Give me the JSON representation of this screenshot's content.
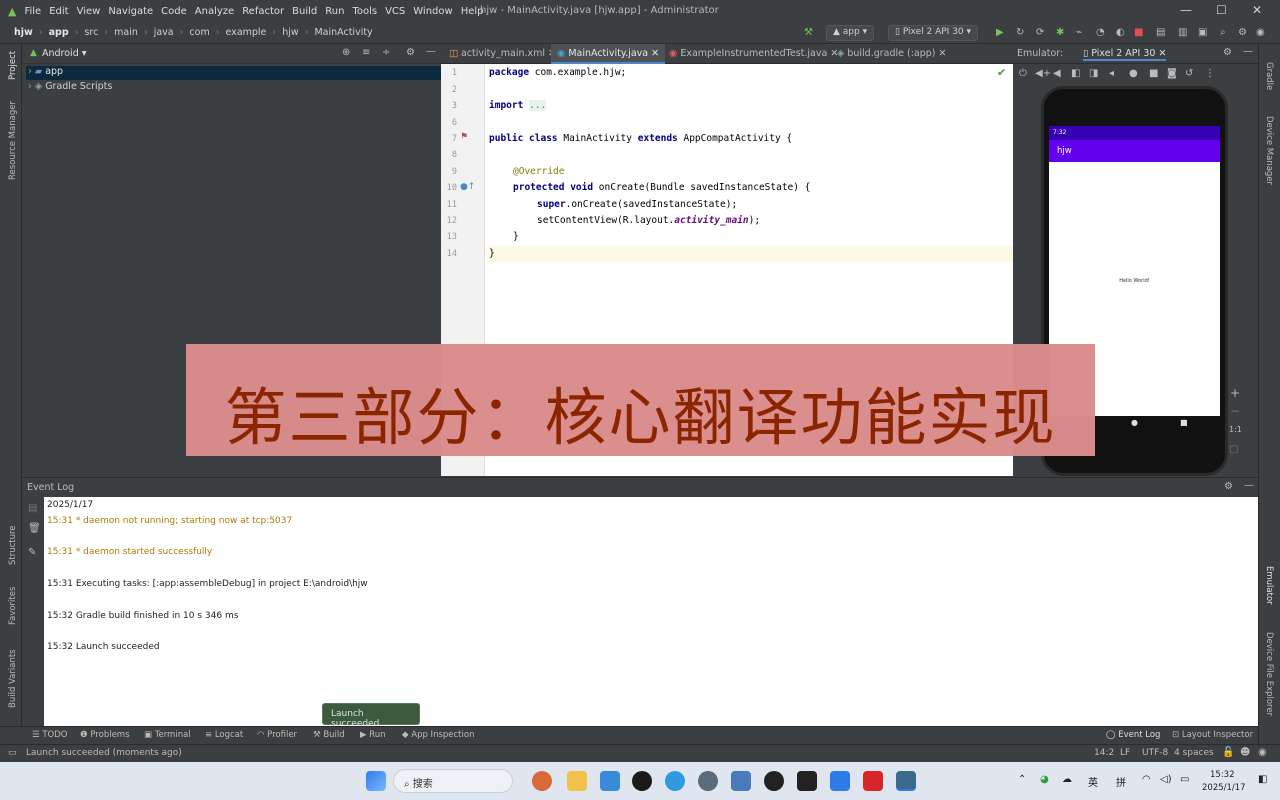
{
  "window": {
    "title": "hjw - MainActivity.java [hjw.app] - Administrator",
    "menu": [
      "File",
      "Edit",
      "View",
      "Navigate",
      "Code",
      "Analyze",
      "Refactor",
      "Build",
      "Run",
      "Tools",
      "VCS",
      "Window",
      "Help"
    ]
  },
  "breadcrumb": [
    "hjw",
    "app",
    "src",
    "main",
    "java",
    "com",
    "example",
    "hjw",
    "MainActivity"
  ],
  "toolbar": {
    "run_config": "app",
    "device": "Pixel 2 API 30"
  },
  "left_strip": [
    "Project",
    "Resource Manager",
    "Structure",
    "Favorites",
    "Build Variants"
  ],
  "project": {
    "view_selector": "Android",
    "items": [
      "app",
      "Gradle Scripts"
    ]
  },
  "editor": {
    "tabs": [
      "activity_main.xml",
      "MainActivity.java",
      "ExampleInstrumentedTest.java",
      "build.gradle (:app)"
    ],
    "line_numbers": [
      "1",
      "2",
      "3",
      "6",
      "7",
      "8",
      "9",
      "10",
      "11",
      "12",
      "13",
      "14"
    ],
    "code": {
      "l1_kw": "package",
      "l1_rest": " com.example.hjw;",
      "l3_kw": "import",
      "l3_fold": "...",
      "l7_kw1": "public class",
      "l7_name": " MainActivity ",
      "l7_kw2": "extends",
      "l7_rest": " AppCompatActivity {",
      "l9_ann": "@Override",
      "l10_kw": "protected void",
      "l10_rest": " onCreate(Bundle savedInstanceState) {",
      "l11_kw": "super",
      ".l11_rest": "",
      "l11_rest": ".onCreate(savedInstanceState);",
      "l12_rest1": "setContentView(R.layout.",
      "l12_it": "activity_main",
      "l12_rest2": ");",
      "l13": "}",
      "l14": "}"
    }
  },
  "emulator": {
    "header_label": "Emulator:",
    "tab": "Pixel 2 API 30",
    "app_title": "hjw",
    "status_time": "7:32",
    "body_text": "Hello World!",
    "zoom": "1:1"
  },
  "right_strip": [
    "Gradle",
    "Device Manager",
    "Emulator",
    "Device File Explorer"
  ],
  "event_log": {
    "title": "Event Log",
    "date": "2025/1/17",
    "lines": [
      {
        "time": "15:31",
        "text": "* daemon not running; starting now at tcp:5037"
      },
      {
        "time": "15:31",
        "text": "* daemon started successfully"
      },
      {
        "time": "15:31",
        "text": "Executing tasks: [:app:assembleDebug] in project E:\\android\\hjw"
      },
      {
        "time": "15:32",
        "text": "Gradle build finished in 10 s 346 ms"
      },
      {
        "time": "15:32",
        "text": "Launch succeeded"
      }
    ]
  },
  "toast": "Launch succeeded",
  "bottom_tools": [
    "TODO",
    "Problems",
    "Terminal",
    "Logcat",
    "Profiler",
    "Build",
    "Run",
    "App Inspection",
    "Event Log",
    "Layout Inspector"
  ],
  "statusline": {
    "message": "Launch succeeded (moments ago)",
    "position": "14:2",
    "line_sep": "LF",
    "encoding": "UTF-8",
    "indent": "4 spaces"
  },
  "overlay_caption": "第三部分：核心翻译功能实现",
  "taskbar": {
    "search": "搜索",
    "ime1": "英",
    "ime2": "拼",
    "time": "15:32",
    "date": "2025/1/17"
  }
}
